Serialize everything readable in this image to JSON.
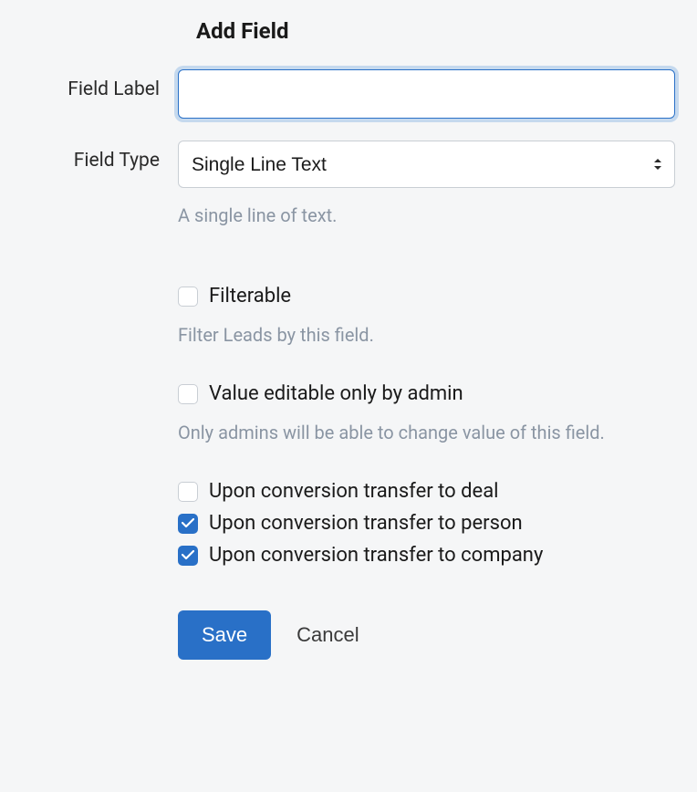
{
  "title": "Add Field",
  "labels": {
    "field_label": "Field Label",
    "field_type": "Field Type"
  },
  "field_label_value": "",
  "field_type": {
    "selected": "Single Line Text",
    "help": "A single line of text."
  },
  "filterable": {
    "label": "Filterable",
    "checked": false,
    "help": "Filter Leads by this field."
  },
  "admin_only": {
    "label": "Value editable only by admin",
    "checked": false,
    "help": "Only admins will be able to change value of this field."
  },
  "conversion": {
    "to_deal": {
      "label": "Upon conversion transfer to deal",
      "checked": false
    },
    "to_person": {
      "label": "Upon conversion transfer to person",
      "checked": true
    },
    "to_company": {
      "label": "Upon conversion transfer to company",
      "checked": true
    }
  },
  "buttons": {
    "save": "Save",
    "cancel": "Cancel"
  }
}
